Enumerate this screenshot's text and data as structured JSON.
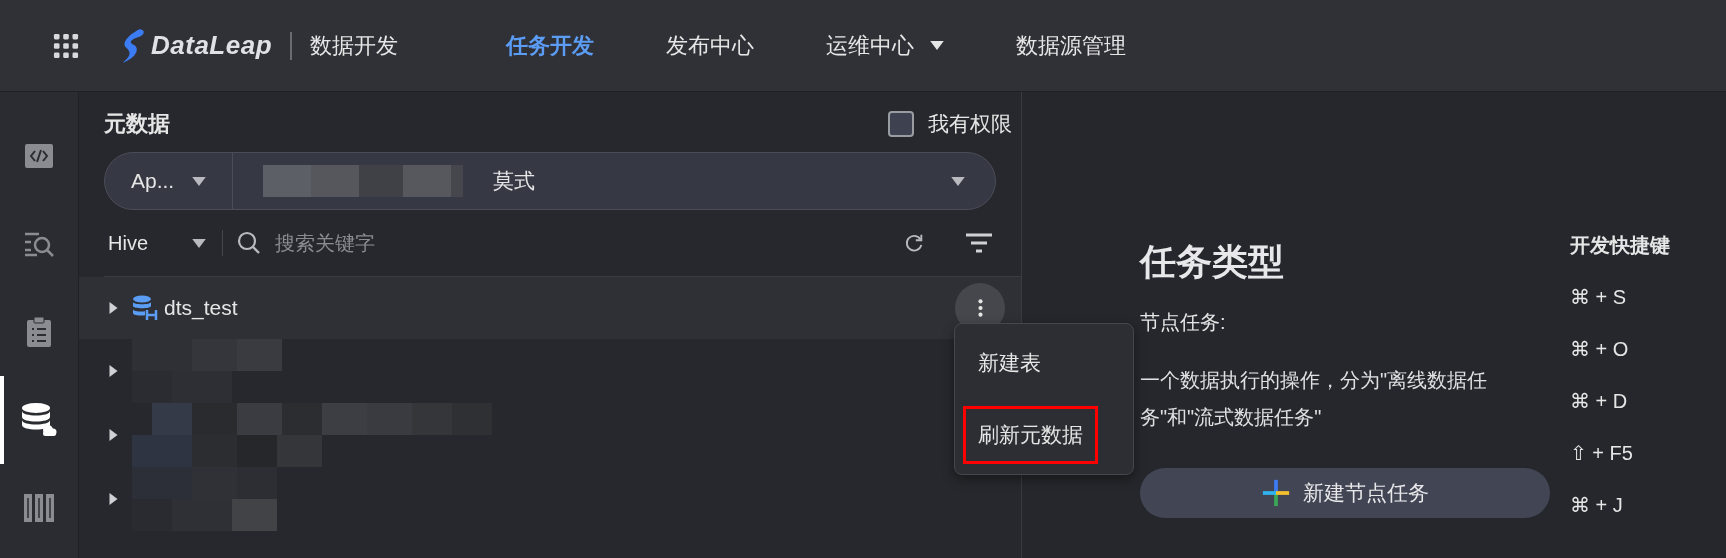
{
  "top_bar": {
    "product": "DataLeap",
    "module": "数据开发",
    "nav": [
      {
        "label": "任务开发",
        "selected": true,
        "dropdown": false
      },
      {
        "label": "发布中心",
        "selected": false,
        "dropdown": false
      },
      {
        "label": "运维中心",
        "selected": false,
        "dropdown": true
      },
      {
        "label": "数据源管理",
        "selected": false,
        "dropdown": false
      }
    ]
  },
  "rail": [
    {
      "kind": "code",
      "selected": false
    },
    {
      "kind": "search",
      "selected": false
    },
    {
      "kind": "clipboard",
      "selected": false
    },
    {
      "kind": "database",
      "selected": true
    },
    {
      "kind": "books",
      "selected": false
    }
  ],
  "metadata_panel": {
    "title": "元数据",
    "permission_checkbox": {
      "label": "我有权限",
      "checked": false
    },
    "project_select": {
      "value": "Ap..."
    },
    "schema_select": {
      "value": "莫式",
      "redacted": true
    },
    "source_select": {
      "value": "Hive"
    },
    "search": {
      "placeholder": "搜索关键字"
    },
    "tree": [
      {
        "kind": "database",
        "name": "dts_test",
        "highlighted": true
      },
      {
        "kind": "redacted",
        "highlighted": false
      },
      {
        "kind": "redacted",
        "highlighted": false
      },
      {
        "kind": "redacted",
        "highlighted": false
      }
    ],
    "context_menu": [
      {
        "label": "新建表",
        "outlined": false
      },
      {
        "label": "刷新元数据",
        "outlined": true
      }
    ]
  },
  "task_types": {
    "title": "任务类型",
    "subtitle": "节点任务:",
    "description": "一个数据执行的操作，分为\"离线数据任务\"和\"流式数据任务\"",
    "button": "新建节点任务"
  },
  "shortcuts": {
    "title": "开发快捷键",
    "items": [
      "⌘ + S",
      "⌘ + O",
      "⌘ + D",
      "⇧ + F5",
      "⌘ + J"
    ]
  }
}
